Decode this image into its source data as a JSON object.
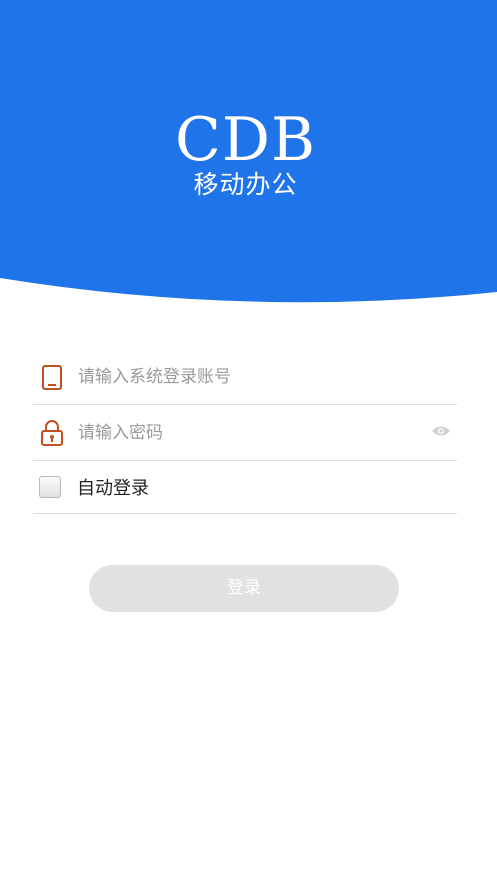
{
  "header": {
    "brand": "CDB",
    "subtitle": "移动办公"
  },
  "form": {
    "account_placeholder": "请输入系统登录账号",
    "password_placeholder": "请输入密码",
    "auto_login_label": "自动登录",
    "auto_login_checked": false
  },
  "actions": {
    "login_label": "登录"
  },
  "icons": {
    "account": "phone-icon",
    "password": "lock-icon",
    "password_visibility": "eye-icon"
  },
  "colors": {
    "brand_blue": "#1f74ea",
    "icon_red": "#c4501f",
    "button_disabled": "#e1e1e1"
  }
}
